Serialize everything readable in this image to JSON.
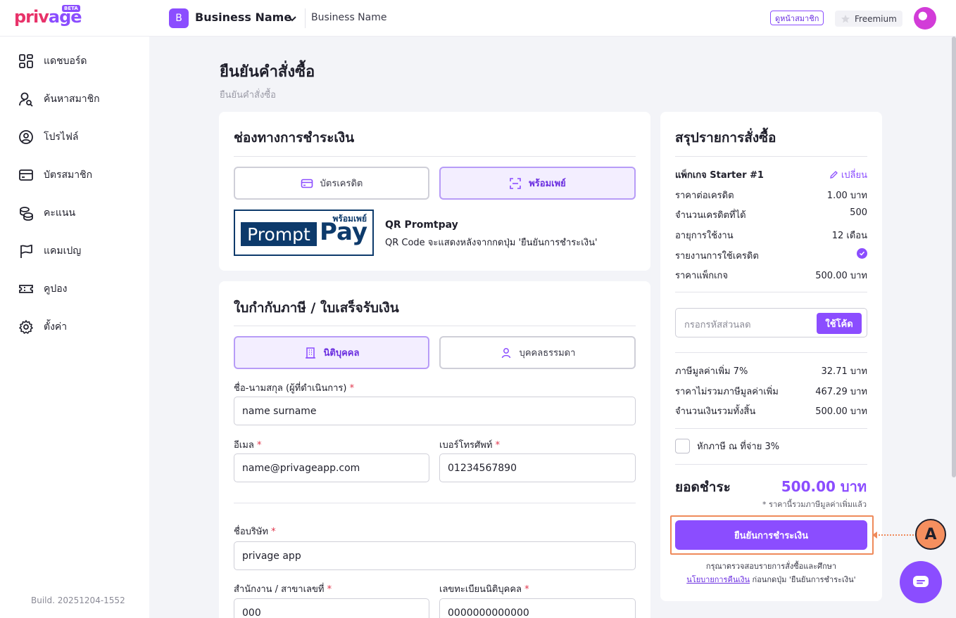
{
  "topbar": {
    "logo_a": "priv",
    "logo_b": "age",
    "beta": "BETA",
    "business_initial": "B",
    "business_name": "Business Name",
    "business_name_secondary": "Business Name",
    "member_button": "ดูหน้าสมาชิก",
    "plan": "Freemium"
  },
  "sidebar": {
    "items": [
      {
        "label": "แดชบอร์ด",
        "icon": "dashboard-icon"
      },
      {
        "label": "ค้นหาสมาชิก",
        "icon": "search-member-icon"
      },
      {
        "label": "โปรไฟล์",
        "icon": "profile-icon"
      },
      {
        "label": "บัตรสมาชิก",
        "icon": "card-icon"
      },
      {
        "label": "คะแนน",
        "icon": "coins-icon"
      },
      {
        "label": "แคมเปญ",
        "icon": "flag-icon"
      },
      {
        "label": "คูปอง",
        "icon": "ticket-icon"
      },
      {
        "label": "ตั้งค่า",
        "icon": "gear-icon"
      }
    ],
    "build": "Build. 20251204-1552"
  },
  "page": {
    "title": "ยืนยันคำสั่งซื้อ",
    "breadcrumb": "ยืนยันคำสั่งซื้อ"
  },
  "payment": {
    "title": "ช่องทางการชำระเงิน",
    "options": [
      "บัตรเครดิต",
      "พร้อมเพย์"
    ],
    "selected": "พร้อมเพย์",
    "promptpay_top": "พร้อมเพย์",
    "promptpay_word": "Prompt",
    "promptpay_pay": "Pay",
    "qr_title": "QR Promtpay",
    "qr_desc": "QR Code จะแสดงหลังจากกดปุ่ม 'ยืนยันการชำระเงิน'"
  },
  "tax": {
    "title": "ใบกำกับภาษี / ใบเสร็จรับเงิน",
    "types": [
      "นิติบุคคล",
      "บุคคลธรรมดา"
    ],
    "selected": "นิติบุคคล",
    "fields": {
      "name_label": "ชื่อ-นามสกุล (ผู้ที่ดำเนินการ)",
      "name_value": "name surname",
      "email_label": "อีเมล",
      "email_value": "name@privageapp.com",
      "phone_label": "เบอร์โทรศัพท์",
      "phone_value": "01234567890",
      "company_label": "ชื่อบริษัท",
      "company_value": "privage app",
      "branch_label": "สำนักงาน / สาขาเลขที่",
      "branch_value": "000",
      "taxid_label": "เลขทะเบียนนิติบุคคล",
      "taxid_value": "0000000000000"
    },
    "required_mark": "*"
  },
  "summary": {
    "title": "สรุปรายการสั่งซื้อ",
    "package": "แพ็กเกจ Starter #1",
    "change": "เปลี่ยน",
    "rows": [
      {
        "label": "ราคาต่อเครดิต",
        "value": "1.00 บาท"
      },
      {
        "label": "จำนวนเครดิตที่ได้",
        "value": "500"
      },
      {
        "label": "อายุการใช้งาน",
        "value": "12 เดือน"
      },
      {
        "label": "รายงานการใช้เครดิต",
        "value": ""
      },
      {
        "label": "ราคาแพ็กเกจ",
        "value": "500.00 บาท"
      }
    ],
    "credit_report_included": true,
    "coupon_placeholder": "กรอกรหัสส่วนลด",
    "coupon_button": "ใช้โค้ด",
    "tax_rows": [
      {
        "label": "ภาษีมูลค่าเพิ่ม 7%",
        "value": "32.71 บาท"
      },
      {
        "label": "ราคาไม่รวมภาษีมูลค่าเพิ่ม",
        "value": "467.29 บาท"
      },
      {
        "label": "จำนวนเงินรวมทั้งสิ้น",
        "value": "500.00 บาท"
      }
    ],
    "withholding": "หักภาษี ณ ที่จ่าย 3%",
    "total_label": "ยอดชำระ",
    "total_value": "500.00 บาท",
    "vat_note": "* ราคานี้รวมภาษีมูลค่าเพิ่มแล้ว",
    "confirm_button": "ยืนยันการชำระเงิน",
    "note_line1": "กรุณาตรวจสอบรายการสั่งซื้อและศึกษา",
    "note_link": "นโยบายการคืนเงิน",
    "note_line2": " ก่อนกดปุ่ม 'ยืนยันการชำระเงิน'"
  },
  "annotation": {
    "label": "A"
  },
  "colors": {
    "accent": "#8b4dff",
    "highlight": "#ef8a5a",
    "required": "#e0354b"
  }
}
